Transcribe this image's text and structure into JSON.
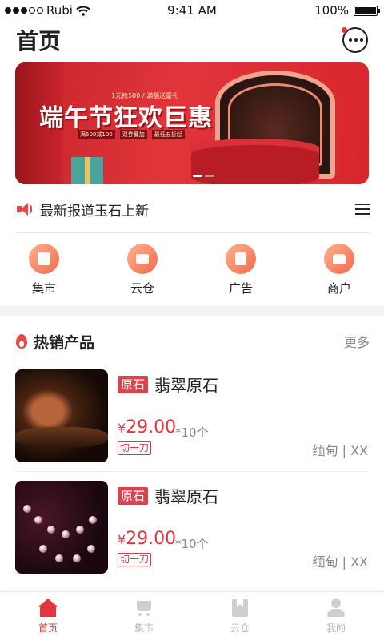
{
  "status_bar": {
    "carrier": "Rubi",
    "time": "9:41 AM",
    "battery": "100%"
  },
  "header": {
    "title": "首页"
  },
  "banner": {
    "small_text": "1元抢500 / 满额送豪礼",
    "headline": "端午节狂欢巨惠",
    "tags": [
      "满500减100",
      "双券叠加",
      "最低五折起"
    ]
  },
  "notice": {
    "text": "最新报道玉石上新"
  },
  "categories": [
    {
      "label": "集市",
      "icon": "bag-icon"
    },
    {
      "label": "云仓",
      "icon": "box-icon"
    },
    {
      "label": "广告",
      "icon": "doc-icon"
    },
    {
      "label": "商户",
      "icon": "shop-icon"
    }
  ],
  "hot_section": {
    "title": "热销产品",
    "more": "更多"
  },
  "products": [
    {
      "tag": "原石",
      "name": "翡翠原石",
      "currency": "¥",
      "price": "29.00",
      "qty": "*10个",
      "badge": "切一刀",
      "origin": "缅甸 | XX"
    },
    {
      "tag": "原石",
      "name": "翡翠原石",
      "currency": "¥",
      "price": "29.00",
      "qty": "*10个",
      "badge": "切一刀",
      "origin": "缅甸 | XX"
    }
  ],
  "tabbar": [
    {
      "label": "首页",
      "icon": "home-icon",
      "active": true
    },
    {
      "label": "集市",
      "icon": "cart-icon",
      "active": false
    },
    {
      "label": "云仓",
      "icon": "bookmark-icon",
      "active": false
    },
    {
      "label": "我的",
      "icon": "user-icon",
      "active": false
    }
  ],
  "colors": {
    "accent": "#e0363f",
    "tag_bg": "#d8434d",
    "category_gradient_start": "#ffb28f",
    "category_gradient_end": "#f16a4c"
  }
}
